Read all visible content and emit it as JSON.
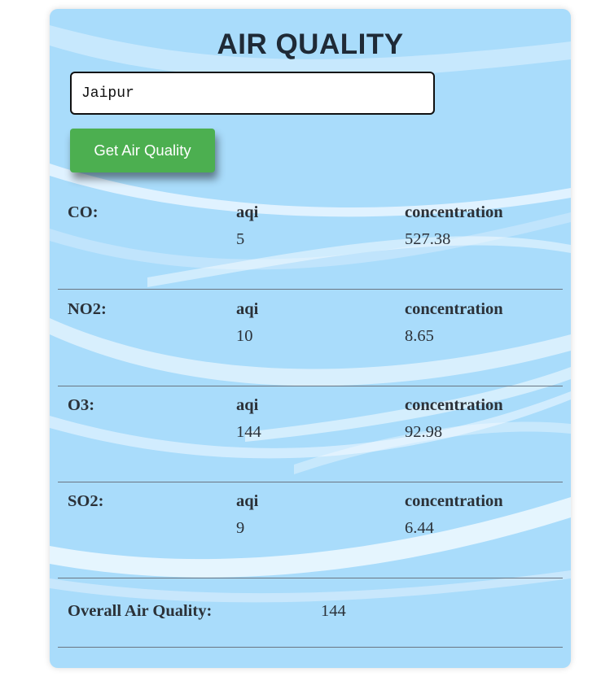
{
  "app": {
    "title": "AIR QUALITY",
    "search": {
      "value": "Jaipur",
      "placeholder": ""
    },
    "button_label": "Get Air Quality",
    "pollutants": [
      {
        "name": "CO:",
        "aqi_label": "aqi",
        "aqi": "5",
        "concentration_label": "concentration",
        "concentration": "527.38"
      },
      {
        "name": "NO2:",
        "aqi_label": "aqi",
        "aqi": "10",
        "concentration_label": "concentration",
        "concentration": "8.65"
      },
      {
        "name": "O3:",
        "aqi_label": "aqi",
        "aqi": "144",
        "concentration_label": "concentration",
        "concentration": "92.98"
      },
      {
        "name": "SO2:",
        "aqi_label": "aqi",
        "aqi": "9",
        "concentration_label": "concentration",
        "concentration": "6.44"
      }
    ],
    "overall": {
      "label": "Overall Air Quality:",
      "value": "144"
    }
  },
  "colors": {
    "card_background": "#a9dcfb",
    "button": "#4caf50",
    "text": "#2b3138",
    "divider": "#6b7682"
  }
}
